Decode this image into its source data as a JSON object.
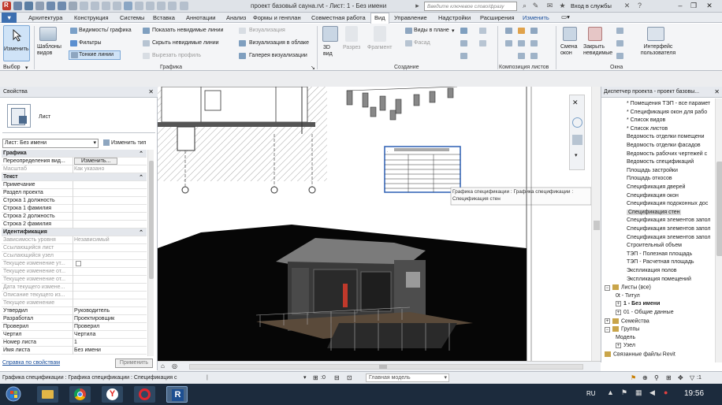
{
  "titlebar": {
    "document_title": "проект базовый сауна.rvt - Лист: 1 - Без имени",
    "search_placeholder": "Введите ключевое слово/фразу",
    "signin": "Вход в службы"
  },
  "menu_tabs": [
    "Архитектура",
    "Конструкция",
    "Системы",
    "Вставка",
    "Аннотации",
    "Анализ",
    "Формы и генплан",
    "Совместная работа",
    "Вид",
    "Управление",
    "Надстройки",
    "Расширения",
    "Изменить"
  ],
  "active_tab": "Вид",
  "ribbon": {
    "select": {
      "modify": "Изменить",
      "select_label": "Выбор"
    },
    "graphics": {
      "title": "Графика",
      "view_templates": "Шаблоны видов",
      "visibility": "Видимость/ графика",
      "filters": "Фильтры",
      "thin_lines": "Тонкие линии",
      "show_hidden": "Показать невидимые линии",
      "hide_hidden": "Скрыть невидимые линии",
      "cut_profile": "Вырезать профиль",
      "render": "Визуализация",
      "render_cloud": "Визуализация в облаке",
      "render_gallery": "Галерея визуализации"
    },
    "create": {
      "title": "Создание",
      "view3d": "3D вид",
      "section": "Разрез",
      "callout": "Фрагмент",
      "plan_views": "Виды в плане",
      "elevation": "Фасад"
    },
    "sheet_composition": {
      "title": "Композиция листов"
    },
    "windows": {
      "title": "Окна",
      "switch_windows": "Смена окон",
      "close_hidden": "Закрыть невидимые",
      "user_interface": "Интерфейс пользователя"
    }
  },
  "properties": {
    "header": "Свойства",
    "type_name": "Лист",
    "instance_selector": "Лист: Без имени",
    "edit_type": "Изменить тип",
    "apply_link": "Справка по свойствам",
    "apply_button": "Применить",
    "rows": [
      {
        "k": "Графика",
        "v": "",
        "group": true
      },
      {
        "k": "Переопределения вид...",
        "v": "Изменить...",
        "button": true
      },
      {
        "k": "Масштаб",
        "v": "Как указано",
        "dim": true
      },
      {
        "k": "Текст",
        "v": "",
        "group": true
      },
      {
        "k": "Примечание",
        "v": ""
      },
      {
        "k": "Раздел проекта",
        "v": ""
      },
      {
        "k": "Строка 1 должность",
        "v": ""
      },
      {
        "k": "Строка 1 фамилия",
        "v": ""
      },
      {
        "k": "Строка 2 должность",
        "v": ""
      },
      {
        "k": "Строка 2 фамилия",
        "v": ""
      },
      {
        "k": "Идентификация",
        "v": "",
        "group": true
      },
      {
        "k": "Зависимость уровня",
        "v": "Независимый",
        "dim": true
      },
      {
        "k": "Ссылающийся лист",
        "v": "",
        "dim": true
      },
      {
        "k": "Ссылающийся узел",
        "v": "",
        "dim": true
      },
      {
        "k": "Текущее изменение ут...",
        "v": "",
        "dim": true,
        "check": true
      },
      {
        "k": "Текущее изменение от...",
        "v": "",
        "dim": true
      },
      {
        "k": "Текущее изменение от...",
        "v": "",
        "dim": true
      },
      {
        "k": "Дата текущего измене...",
        "v": "",
        "dim": true
      },
      {
        "k": "Описание текущего из...",
        "v": "",
        "dim": true
      },
      {
        "k": "Текущее изменение",
        "v": "",
        "dim": true
      },
      {
        "k": "Утвердил",
        "v": "Руководитель"
      },
      {
        "k": "Разработал",
        "v": "Проектировщик"
      },
      {
        "k": "Проверил",
        "v": "Проверил"
      },
      {
        "k": "Чертил",
        "v": "Чертила"
      },
      {
        "k": "Номер листа",
        "v": "1"
      },
      {
        "k": "Имя листа",
        "v": "Без имени"
      }
    ]
  },
  "canvas": {
    "tooltip_line1": "Графика спецификации : Графика спецификации :",
    "tooltip_line2": "Спецификация стен"
  },
  "project_browser": {
    "header": "Диспетчер проекта - проект базовы...",
    "items": [
      {
        "label": "* Помещения ТЭП - все парамет",
        "indent": 2
      },
      {
        "label": "* Спецификация окон для рабо",
        "indent": 2
      },
      {
        "label": "* Список видов",
        "indent": 2
      },
      {
        "label": "* Список листов",
        "indent": 2
      },
      {
        "label": "Ведомость отделки помещени",
        "indent": 2
      },
      {
        "label": "Ведомость отделки фасадов",
        "indent": 2
      },
      {
        "label": "Ведомость рабочих чертежей с",
        "indent": 2
      },
      {
        "label": "Ведомость спецификаций",
        "indent": 2
      },
      {
        "label": "Площадь застройки",
        "indent": 2
      },
      {
        "label": "Площадь откосов",
        "indent": 2
      },
      {
        "label": "Спецификация дверей",
        "indent": 2
      },
      {
        "label": "Спецификация окон",
        "indent": 2
      },
      {
        "label": "Спецификация подоконных дос",
        "indent": 2
      },
      {
        "label": "Спецификация стен",
        "indent": 2,
        "selected": true
      },
      {
        "label": "Спецификация элементов запол",
        "indent": 2
      },
      {
        "label": "Спецификация элементов запол",
        "indent": 2
      },
      {
        "label": "Спецификация элементов запол",
        "indent": 2
      },
      {
        "label": "Строительный объем",
        "indent": 2
      },
      {
        "label": "ТЭП - Полезная площадь",
        "indent": 2
      },
      {
        "label": "ТЭП - Расчетная площадь",
        "indent": 2
      },
      {
        "label": "Экспликация полов",
        "indent": 2
      },
      {
        "label": "Экспликация помещений",
        "indent": 2
      },
      {
        "label": "Листы (все)",
        "indent": 0,
        "toggle": "−"
      },
      {
        "label": "0t - Титул",
        "indent": 1
      },
      {
        "label": "1 - Без имени",
        "indent": 1,
        "bold": true,
        "toggle": "+"
      },
      {
        "label": "01 - Общие данные",
        "indent": 1,
        "toggle": "+"
      },
      {
        "label": "Семейства",
        "indent": 0,
        "toggle": "+"
      },
      {
        "label": "Группы",
        "indent": 0,
        "toggle": "−"
      },
      {
        "label": "Модель",
        "indent": 1
      },
      {
        "label": "Узел",
        "indent": 1,
        "toggle": "+"
      },
      {
        "label": "Связанные файлы Revit",
        "indent": 0
      }
    ]
  },
  "statusbar": {
    "message": "Графика спецификации : Графика спецификации : Спецификация с",
    "coord": ":0",
    "model": "Главная модель"
  },
  "taskbar": {
    "lang": "RU",
    "time": "19:56"
  },
  "colors": {
    "titlebar": "#dfe3e8",
    "taskbar": "#1c2b3d",
    "selection": "#2b5fb4"
  }
}
